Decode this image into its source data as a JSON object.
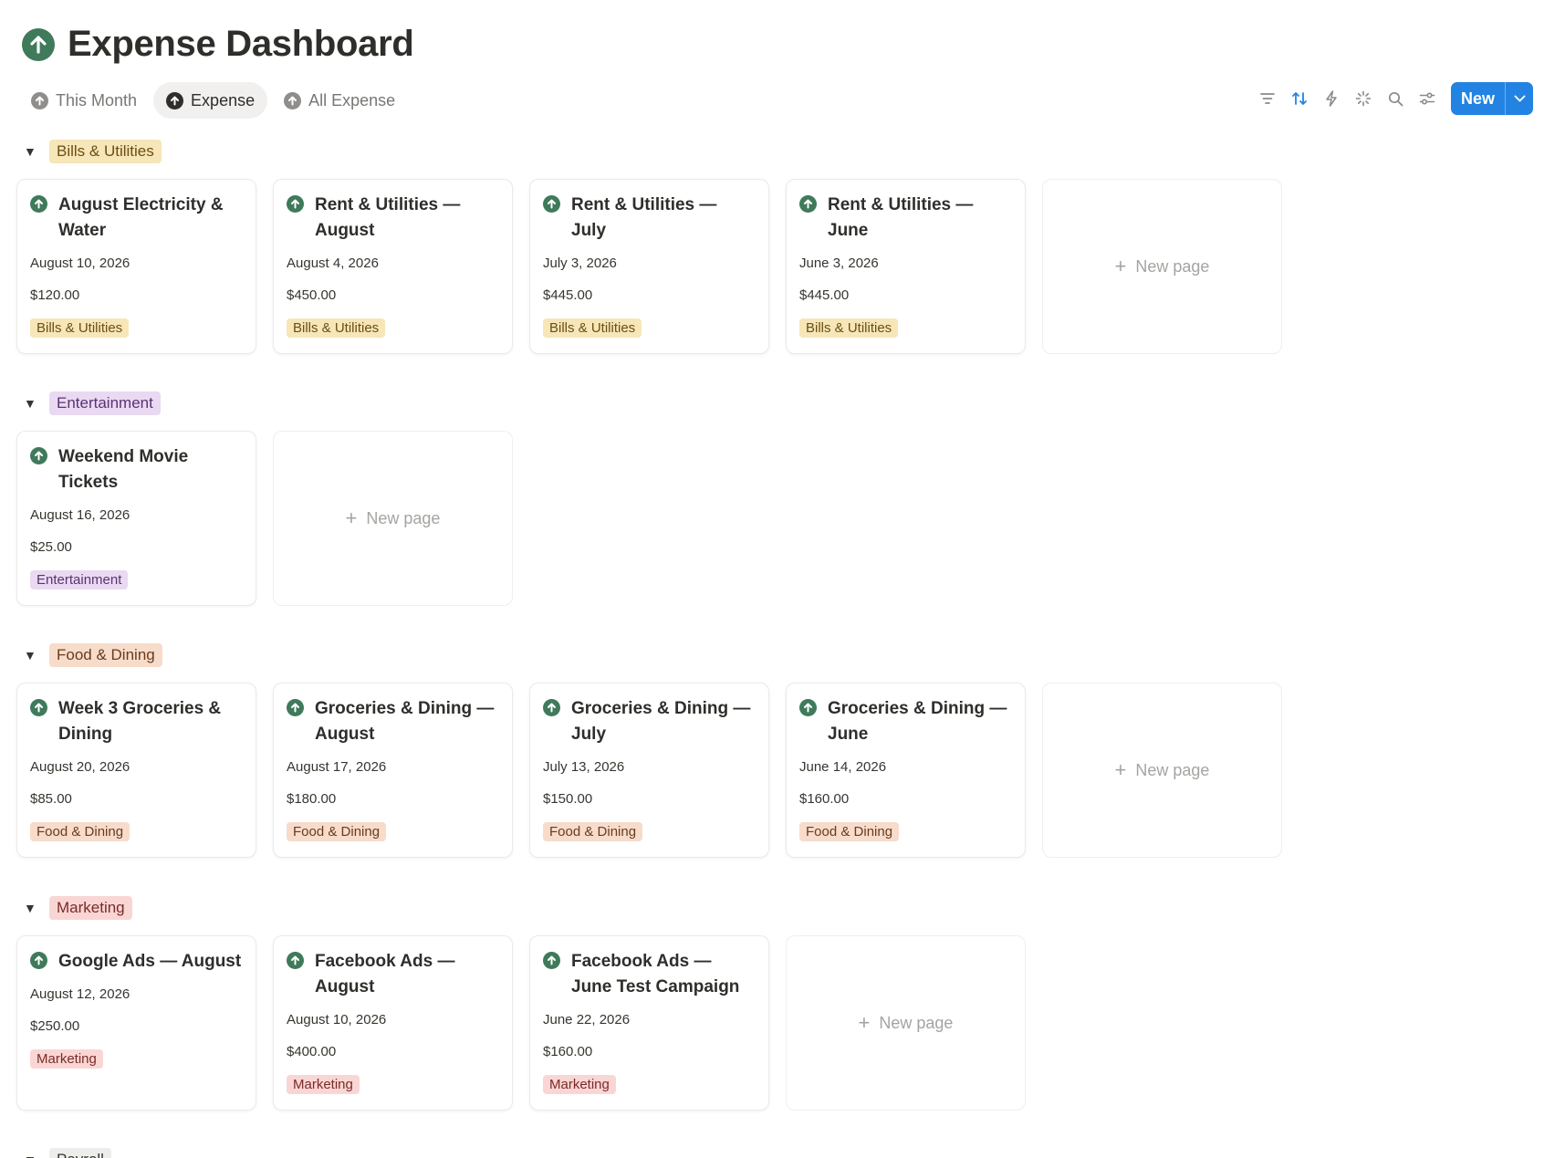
{
  "page": {
    "title": "Expense Dashboard"
  },
  "tabs": [
    {
      "label": "This Month"
    },
    {
      "label": "Expense"
    },
    {
      "label": "All Expense"
    }
  ],
  "toolbar": {
    "new_label": "New"
  },
  "new_page_label": "New page",
  "colors": {
    "accent": "#2383e2",
    "icon_green": "#3f7a5b",
    "bills_bg": "#f6e6b8",
    "entertainment_bg": "#ead9f2",
    "food_bg": "#f7dccb",
    "marketing_bg": "#f9d6d4",
    "payroll_bg": "#ededeb"
  },
  "groups": [
    {
      "label": "Bills & Utilities",
      "cards": [
        {
          "title": "August Electricity & Water",
          "date": "August 10, 2026",
          "amount": "$120.00",
          "tag": "Bills & Utilities"
        },
        {
          "title": "Rent & Utilities — August",
          "date": "August 4, 2026",
          "amount": "$450.00",
          "tag": "Bills & Utilities"
        },
        {
          "title": "Rent & Utilities — July",
          "date": "July 3, 2026",
          "amount": "$445.00",
          "tag": "Bills & Utilities"
        },
        {
          "title": "Rent & Utilities — June",
          "date": "June 3, 2026",
          "amount": "$445.00",
          "tag": "Bills & Utilities"
        }
      ]
    },
    {
      "label": "Entertainment",
      "cards": [
        {
          "title": "Weekend Movie Tickets",
          "date": "August 16, 2026",
          "amount": "$25.00",
          "tag": "Entertainment"
        }
      ]
    },
    {
      "label": "Food & Dining",
      "cards": [
        {
          "title": "Week 3 Groceries & Dining",
          "date": "August 20, 2026",
          "amount": "$85.00",
          "tag": "Food & Dining"
        },
        {
          "title": "Groceries & Dining — August",
          "date": "August 17, 2026",
          "amount": "$180.00",
          "tag": "Food & Dining"
        },
        {
          "title": "Groceries & Dining — July",
          "date": "July 13, 2026",
          "amount": "$150.00",
          "tag": "Food & Dining"
        },
        {
          "title": "Groceries & Dining — June",
          "date": "June 14, 2026",
          "amount": "$160.00",
          "tag": "Food & Dining"
        }
      ]
    },
    {
      "label": "Marketing",
      "cards": [
        {
          "title": "Google Ads — August",
          "date": "August 12, 2026",
          "amount": "$250.00",
          "tag": "Marketing"
        },
        {
          "title": "Facebook Ads — August",
          "date": "August 10, 2026",
          "amount": "$400.00",
          "tag": "Marketing"
        },
        {
          "title": "Facebook Ads — June Test Campaign",
          "date": "June 22, 2026",
          "amount": "$160.00",
          "tag": "Marketing"
        }
      ]
    },
    {
      "label": "Payroll",
      "cards": []
    }
  ]
}
